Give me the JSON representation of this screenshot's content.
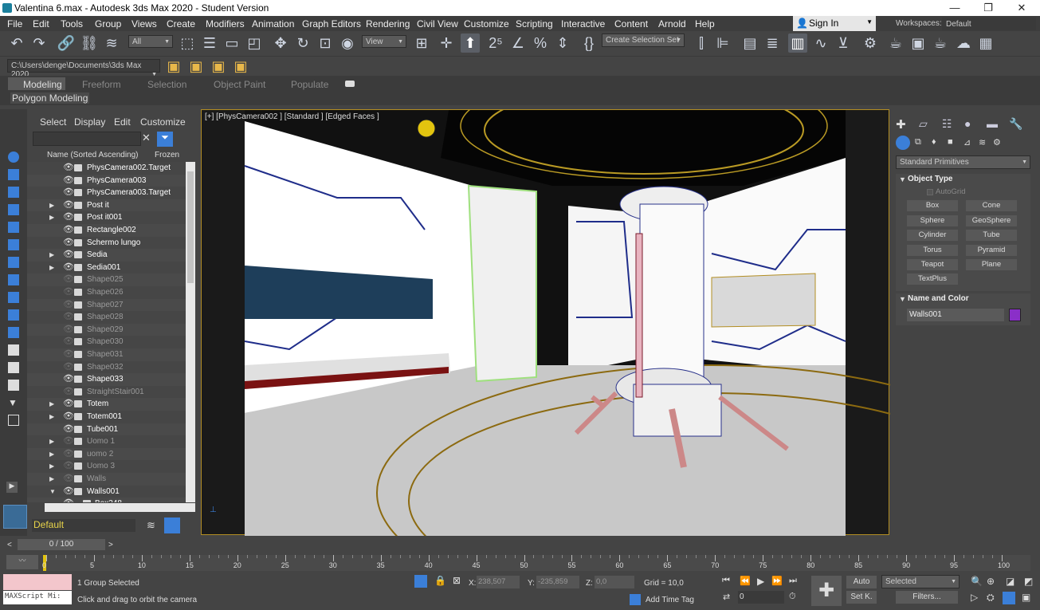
{
  "window": {
    "title": "Valentina 6.max - Autodesk 3ds Max 2020 - Student Version",
    "minimize": "—",
    "maximize": "❐",
    "close": "✕"
  },
  "menu": [
    "File",
    "Edit",
    "Tools",
    "Group",
    "Views",
    "Create",
    "Modifiers",
    "Animation",
    "Graph Editors",
    "Rendering",
    "Civil View",
    "Customize",
    "Scripting",
    "Interactive",
    "Content",
    "Arnold",
    "Help"
  ],
  "signin": {
    "label": "Sign In"
  },
  "workspaces": {
    "label": "Workspaces:",
    "value": "Default"
  },
  "toolbar": {
    "filter": "All",
    "refcoord": "View",
    "selection_set": "Create Selection Set"
  },
  "project_path": "C:\\Users\\denge\\Documents\\3ds Max 2020",
  "ribbon": {
    "tabs": [
      "Modeling",
      "Freeform",
      "Selection",
      "Object Paint",
      "Populate"
    ],
    "active_tab": "Modeling",
    "panel": "Polygon Modeling"
  },
  "scene_explorer": {
    "menus": [
      "Select",
      "Display",
      "Edit",
      "Customize"
    ],
    "col_name": "Name (Sorted Ascending)",
    "col_frozen": "Frozen",
    "rows": [
      {
        "name": "PhysCamera002.Target",
        "vis": true,
        "exp": false
      },
      {
        "name": "PhysCamera003",
        "vis": true,
        "exp": false
      },
      {
        "name": "PhysCamera003.Target",
        "vis": true,
        "exp": false
      },
      {
        "name": "Post it",
        "vis": true,
        "exp": true
      },
      {
        "name": "Post it001",
        "vis": true,
        "exp": true
      },
      {
        "name": "Rectangle002",
        "vis": true,
        "exp": false
      },
      {
        "name": "Schermo lungo",
        "vis": true,
        "exp": false
      },
      {
        "name": "Sedia",
        "vis": true,
        "exp": true
      },
      {
        "name": "Sedia001",
        "vis": true,
        "exp": true
      },
      {
        "name": "Shape025",
        "vis": false,
        "exp": false
      },
      {
        "name": "Shape026",
        "vis": false,
        "exp": false
      },
      {
        "name": "Shape027",
        "vis": false,
        "exp": false
      },
      {
        "name": "Shape028",
        "vis": false,
        "exp": false
      },
      {
        "name": "Shape029",
        "vis": false,
        "exp": false
      },
      {
        "name": "Shape030",
        "vis": false,
        "exp": false
      },
      {
        "name": "Shape031",
        "vis": false,
        "exp": false
      },
      {
        "name": "Shape032",
        "vis": false,
        "exp": false
      },
      {
        "name": "Shape033",
        "vis": true,
        "exp": false
      },
      {
        "name": "StraightStair001",
        "vis": false,
        "exp": false
      },
      {
        "name": "Totem",
        "vis": true,
        "exp": true
      },
      {
        "name": "Totem001",
        "vis": true,
        "exp": true
      },
      {
        "name": "Tube001",
        "vis": true,
        "exp": false
      },
      {
        "name": "Uomo 1",
        "vis": false,
        "exp": true
      },
      {
        "name": "uomo 2",
        "vis": false,
        "exp": true
      },
      {
        "name": "Uomo 3",
        "vis": false,
        "exp": true
      },
      {
        "name": "Walls",
        "vis": false,
        "exp": true
      },
      {
        "name": "Walls001",
        "vis": true,
        "exp": true,
        "open": true
      },
      {
        "name": "Box248",
        "vis": true,
        "exp": false,
        "child": true
      }
    ],
    "layer": "Default"
  },
  "viewport": {
    "label": "[+] [PhysCamera002 ] [Standard ] [Edged Faces ]"
  },
  "command_panel": {
    "category": "Standard Primitives",
    "object_type_title": "Object Type",
    "autogrid": "AutoGrid",
    "buttons": [
      "Box",
      "Cone",
      "Sphere",
      "GeoSphere",
      "Cylinder",
      "Tube",
      "Torus",
      "Pyramid",
      "Teapot",
      "Plane",
      "TextPlus"
    ],
    "name_color_title": "Name and Color",
    "object_name": "Walls001",
    "object_color": "#8a2fc8"
  },
  "timeline": {
    "frame": "0 / 100",
    "ticks": [
      "0",
      "5",
      "10",
      "15",
      "20",
      "25",
      "30",
      "35",
      "40",
      "45",
      "50",
      "55",
      "60",
      "65",
      "70",
      "75",
      "80",
      "85",
      "90",
      "95",
      "100"
    ],
    "frame_positions": [
      0,
      5,
      10,
      15,
      20,
      25,
      30,
      35,
      40,
      45,
      50,
      55,
      60,
      65,
      70,
      75,
      80,
      85,
      90,
      95,
      100
    ]
  },
  "status": {
    "maxscript": "MAXScript Mi:",
    "selected": "1 Group Selected",
    "prompt": "Click and drag to orbit the camera",
    "x_label": "X:",
    "x": "238,507",
    "y_label": "Y:",
    "y": "-235,859",
    "z_label": "Z:",
    "z": "0,0",
    "grid": "Grid = 10,0",
    "add_time_tag": "Add Time Tag",
    "auto": "Auto",
    "setk": "Set K.",
    "key_mode": "Selected",
    "filters": "Filters...",
    "current_frame": "0"
  }
}
